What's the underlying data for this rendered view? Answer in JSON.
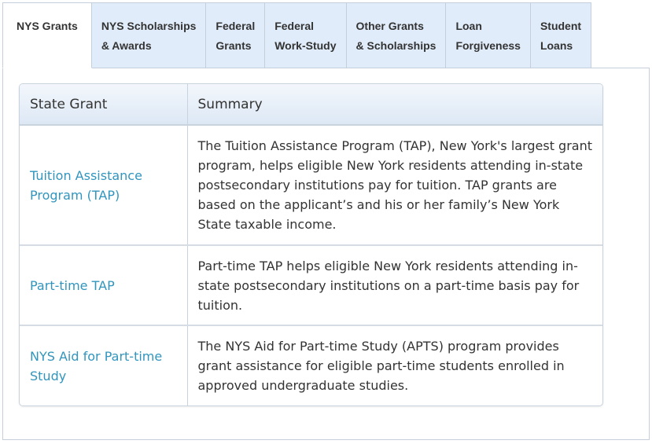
{
  "tabs": [
    {
      "lines": [
        "NYS Grants"
      ]
    },
    {
      "lines": [
        "NYS Scholarships",
        "& Awards"
      ]
    },
    {
      "lines": [
        "Federal",
        "Grants"
      ]
    },
    {
      "lines": [
        "Federal",
        "Work-Study"
      ]
    },
    {
      "lines": [
        "Other Grants",
        "& Scholarships"
      ]
    },
    {
      "lines": [
        "Loan",
        "Forgiveness"
      ]
    },
    {
      "lines": [
        "Student",
        "Loans"
      ]
    }
  ],
  "active_tab": "NYS Grants",
  "table": {
    "headers": {
      "grant": "State Grant",
      "summary": "Summary"
    },
    "rows": [
      {
        "name": "Tuition Assistance Program (TAP)",
        "summary": "The Tuition Assistance Program (TAP), New York's largest grant program, helps eligible New York residents attending in-state postsecondary institutions pay for tuition. TAP grants are based on the applicant’s and his or her family’s New York State taxable income."
      },
      {
        "name": "Part-time TAP",
        "summary": "Part-time TAP helps eligible New York residents attending in-state postsecondary institutions on a part-time basis pay for tuition."
      },
      {
        "name": "NYS Aid for Part-time Study",
        "summary": "The NYS Aid for Part-time Study (APTS) program provides grant assistance for eligible part-time students enrolled in approved undergraduate studies."
      }
    ]
  },
  "colors": {
    "tab_bg": "#e0ecf9",
    "link": "#3195bd",
    "text": "#333333",
    "border": "#c5cfdb"
  }
}
